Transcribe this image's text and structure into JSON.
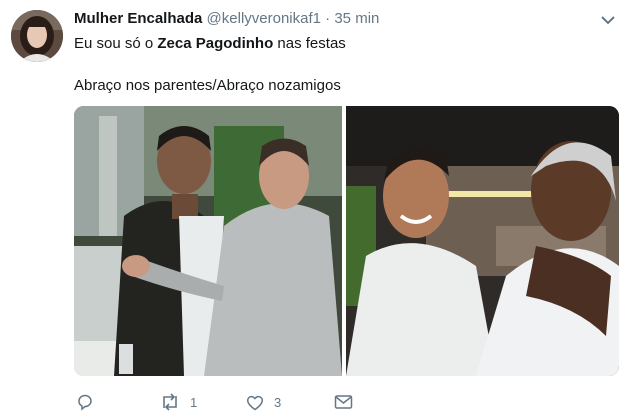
{
  "tweet": {
    "display_name": "Mulher Encalhada",
    "handle": "@kellyveronikaf1",
    "separator": "·",
    "time": "35 min",
    "line1_before": "Eu sou só o ",
    "line1_bold": "Zeca Pagodinho",
    "line1_after": " nas festas",
    "line2": "Abraço nos parentes/Abraço nozamigos"
  },
  "actions": {
    "reply_count": "",
    "retweet_count": "1",
    "like_count": "3"
  },
  "icons": {
    "menu": "chevron-down-icon",
    "reply": "reply-icon",
    "retweet": "retweet-icon",
    "like": "heart-icon",
    "dm": "envelope-icon"
  },
  "colors": {
    "text": "#14171a",
    "secondary": "#657786"
  }
}
